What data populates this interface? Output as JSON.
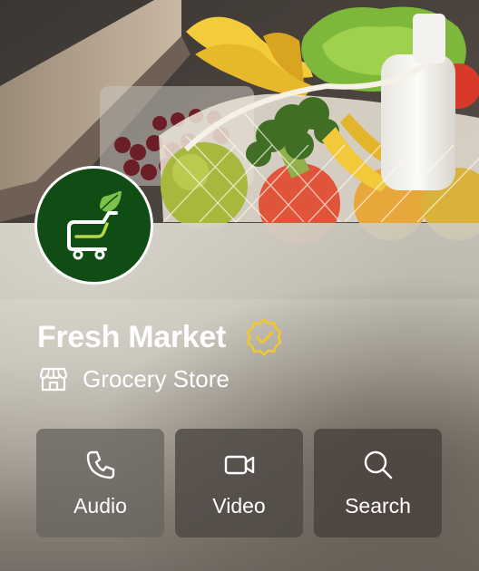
{
  "profile": {
    "name": "Fresh Market",
    "category": "Grocery Store",
    "verified": true,
    "avatar_icon": "shopping-cart-leaf-icon",
    "brand_color": "#0f4d14",
    "verified_color": "#f0c930"
  },
  "actions": [
    {
      "label": "Audio",
      "icon": "phone-icon"
    },
    {
      "label": "Video",
      "icon": "video-camera-icon"
    },
    {
      "label": "Search",
      "icon": "search-icon"
    }
  ]
}
